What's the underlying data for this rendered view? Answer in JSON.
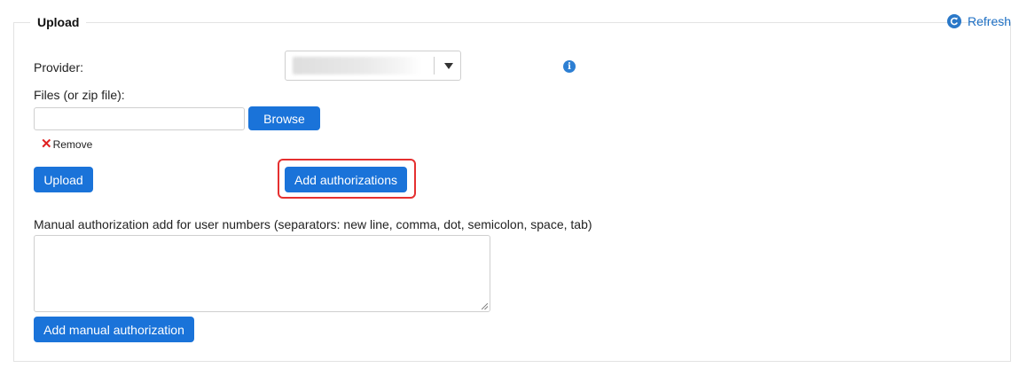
{
  "section": {
    "title": "Upload"
  },
  "refresh": {
    "label": "Refresh",
    "icon": "refresh-icon"
  },
  "provider": {
    "label": "Provider:",
    "selected_value": "",
    "info_icon": "info-icon"
  },
  "files": {
    "label": "Files (or zip file):",
    "value": "",
    "browse_label": "Browse",
    "remove_label": "Remove"
  },
  "actions": {
    "upload_label": "Upload",
    "add_authorizations_label": "Add authorizations"
  },
  "manual": {
    "label": "Manual authorization add for user numbers (separators: new line, comma, dot, semicolon, space, tab)",
    "value": "",
    "add_label": "Add manual authorization"
  },
  "colors": {
    "accent": "#1a73d9",
    "highlight": "#e53030",
    "remove": "#e02020"
  }
}
